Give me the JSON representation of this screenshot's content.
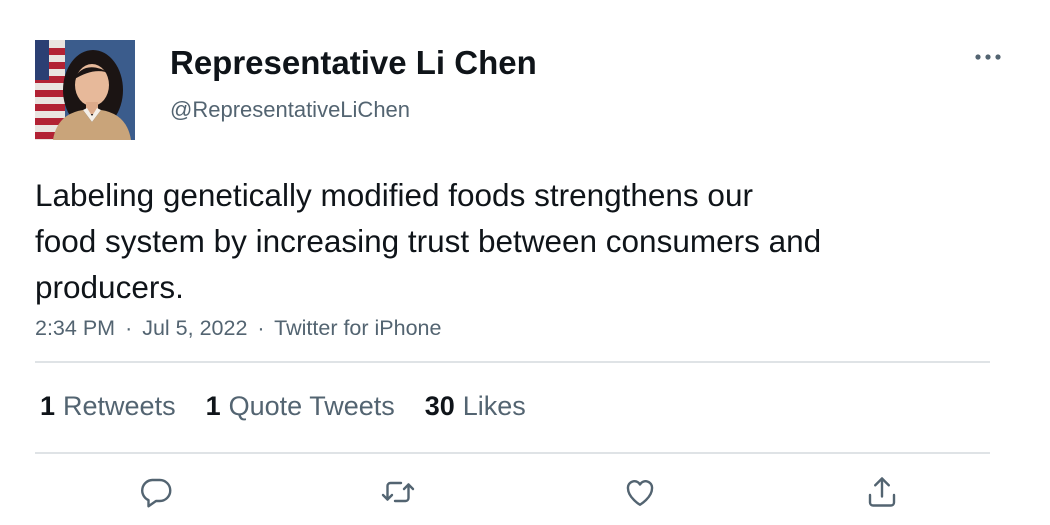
{
  "author": {
    "name": "Representative Li Chen",
    "handle": "@RepresentativeLiChen",
    "avatar_icon": "avatar-photo"
  },
  "tweet": {
    "text_lines": [
      "Labeling genetically modified foods strengthens our",
      "food system by increasing trust between consumers and",
      "producers."
    ],
    "time": "2:34 PM",
    "date": "Jul 5, 2022",
    "separator": "·",
    "source": "Twitter for iPhone"
  },
  "stats": {
    "retweets_count": "1",
    "retweets_label": "Retweets",
    "quotes_count": "1",
    "quotes_label": "Quote Tweets",
    "likes_count": "30",
    "likes_label": "Likes"
  },
  "actions": [
    "reply-icon",
    "retweet-icon",
    "like-icon",
    "share-icon"
  ],
  "more_icon": "more-icon",
  "colors": {
    "text": "#0f1419",
    "secondary": "#536471",
    "divider": "#dfe3e6"
  }
}
